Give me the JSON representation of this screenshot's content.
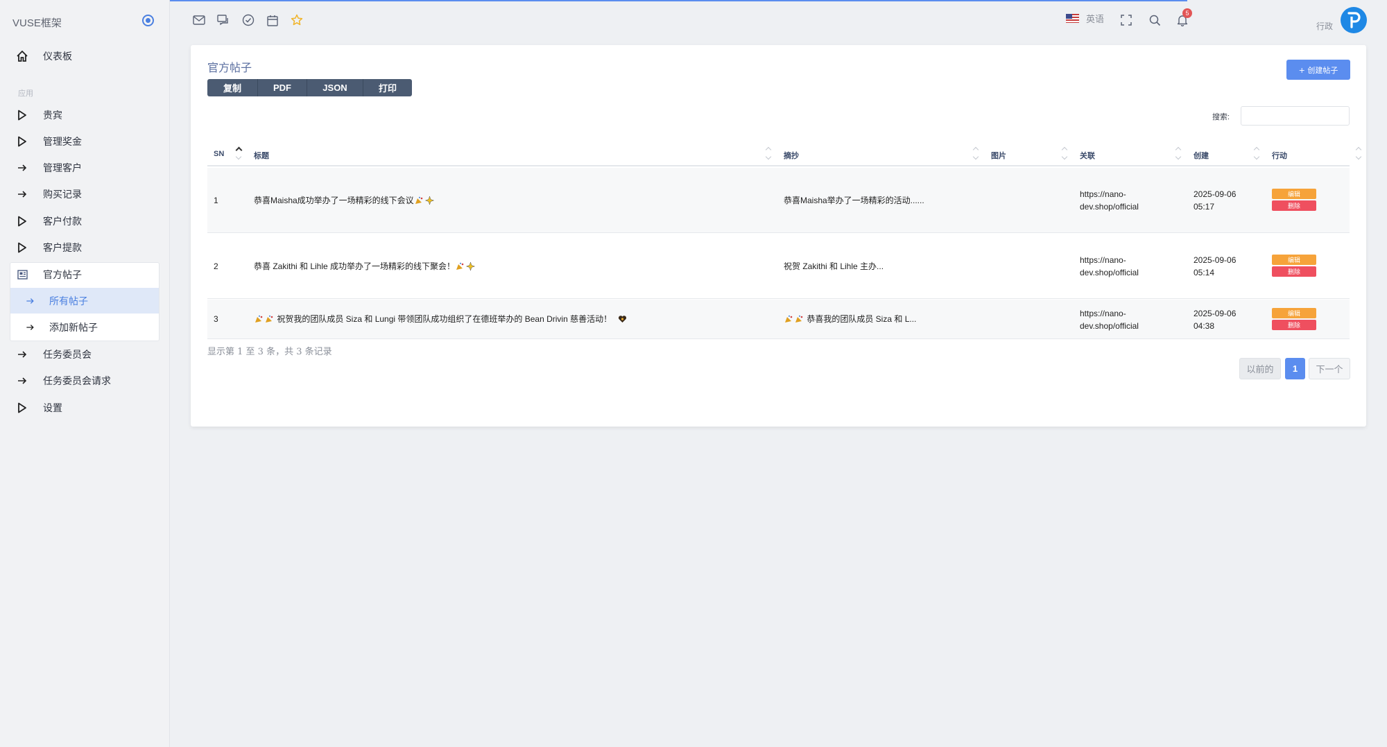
{
  "app": {
    "brand": "VUSE框架"
  },
  "sidebar": {
    "dashboard": "仪表板",
    "section_label": "应用",
    "items": [
      {
        "label": "贵宾",
        "icon": "play-triangle-icon"
      },
      {
        "label": "管理奖金",
        "icon": "play-triangle-icon"
      },
      {
        "label": "管理客户",
        "icon": "arrow-right-icon"
      },
      {
        "label": "购买记录",
        "icon": "arrow-right-icon"
      },
      {
        "label": "客户付款",
        "icon": "play-triangle-icon"
      },
      {
        "label": "客户提款",
        "icon": "play-triangle-icon"
      },
      {
        "label": "官方帖子",
        "icon": "newspaper-icon"
      },
      {
        "label": "任务委员会",
        "icon": "arrow-right-icon"
      },
      {
        "label": "任务委员会请求",
        "icon": "arrow-right-icon"
      },
      {
        "label": "设置",
        "icon": "play-triangle-icon"
      }
    ],
    "sub_items": [
      {
        "label": "所有帖子",
        "active": true
      },
      {
        "label": "添加新帖子",
        "active": false
      }
    ]
  },
  "topbar": {
    "icons": [
      "mail-icon",
      "chat-icon",
      "check-circle-icon",
      "calendar-icon",
      "star-icon"
    ],
    "language": "英语",
    "notification_count": "5",
    "user_role": "行政"
  },
  "card": {
    "title": "官方帖子",
    "create_button": "+ 创建帖子",
    "export_buttons": [
      "复制",
      "PDF",
      "JSON",
      "打印"
    ],
    "search_label": "搜索:",
    "search_value": ""
  },
  "table": {
    "columns": [
      "SN",
      "标题",
      "摘抄",
      "图片",
      "关联",
      "创建",
      "行动"
    ],
    "rows": [
      {
        "sn": "1",
        "title": "恭喜Maisha成功举办了一场精彩的线下会议",
        "excerpt": "恭喜Maisha举办了一场精彩的活动......",
        "link_1": "https://nano-",
        "link_2": "dev.shop/official",
        "date": "2025-09-06",
        "time": "05:17"
      },
      {
        "sn": "2",
        "title": "恭喜 Zakithi 和 Lihle 成功举办了一场精彩的线下聚会！",
        "excerpt": "祝贺 Zakithi 和 Lihle 主办...",
        "link_1": "https://nano-",
        "link_2": "dev.shop/official",
        "date": "2025-09-06",
        "time": "05:14"
      },
      {
        "sn": "3",
        "title": "祝贺我的团队成员 Siza 和 Lungi 带领团队成功组织了在德班举办的 Bean Drivin 慈善活动！",
        "excerpt": "恭喜我的团队成员 Siza 和 L...",
        "link_1": "https://nano-",
        "link_2": "dev.shop/official",
        "date": "2025-09-06",
        "time": "04:38"
      }
    ],
    "edit_label": "编辑",
    "delete_label": "删除"
  },
  "footer": {
    "info": "显示第 1 至 3 条，共 3 条记录",
    "prev": "以前的",
    "current_page": "1",
    "next": "下一个"
  },
  "colors": {
    "accent": "#5b8def",
    "edit": "#f6a33a",
    "delete": "#ef4f5f",
    "export": "#4b5b72"
  }
}
